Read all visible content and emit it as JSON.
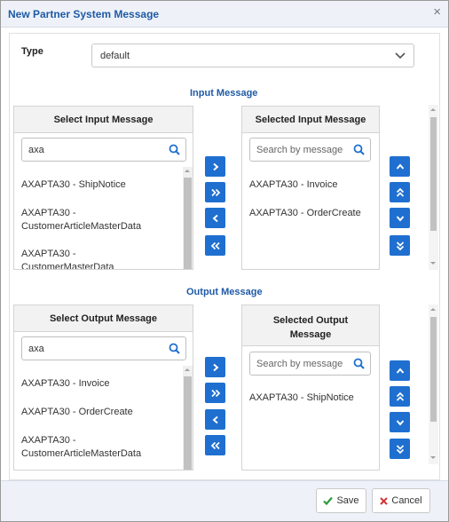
{
  "dialog": {
    "title": "New Partner System Message",
    "close_glyph": "×"
  },
  "type": {
    "label": "Type",
    "value": "default"
  },
  "input": {
    "section_title": "Input Message",
    "available": {
      "header": "Select Input Message",
      "search_value": "axa",
      "items": [
        "AXAPTA30 - ShipNotice",
        "AXAPTA30 -",
        "CustomerArticleMasterData",
        "AXAPTA30 -",
        "CustomerMasterData"
      ]
    },
    "selected": {
      "header": "Selected Input Message",
      "search_placeholder": "Search by message",
      "items": [
        "AXAPTA30 - Invoice",
        "AXAPTA30 - OrderCreate"
      ]
    }
  },
  "output": {
    "section_title": "Output Message",
    "available": {
      "header": "Select Output Message",
      "search_value": "axa",
      "items": [
        "AXAPTA30 - Invoice",
        "AXAPTA30 - OrderCreate",
        "AXAPTA30 -",
        "CustomerArticleMasterData"
      ]
    },
    "selected": {
      "header_line1": "Selected Output",
      "header_line2": "Message",
      "search_placeholder": "Search by message",
      "items": [
        "AXAPTA30 - ShipNotice"
      ]
    }
  },
  "footer": {
    "save_label": "Save",
    "cancel_label": "Cancel"
  },
  "colors": {
    "accent": "#1f6fd0",
    "title": "#1f5aa6",
    "save_check": "#2e9a3a",
    "cancel_x": "#d33333"
  }
}
